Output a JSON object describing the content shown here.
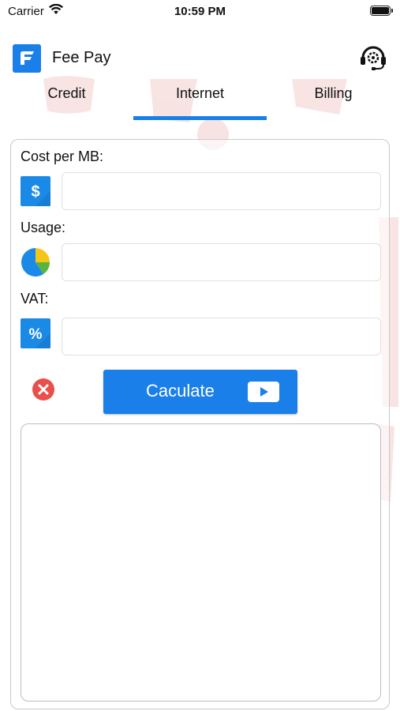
{
  "status_bar": {
    "carrier": "Carrier",
    "time": "10:59 PM"
  },
  "header": {
    "title": "Fee Pay",
    "logo_icon": "fee-pay-logo",
    "support_icon": "headset-gear-icon"
  },
  "tabs": [
    {
      "label": "Credit",
      "active": false
    },
    {
      "label": "Internet",
      "active": true
    },
    {
      "label": "Billing",
      "active": false
    }
  ],
  "form": {
    "fields": [
      {
        "label": "Cost per MB:",
        "icon": "dollar-icon",
        "value": "",
        "placeholder": ""
      },
      {
        "label": "Usage:",
        "icon": "pie-chart-icon",
        "value": "",
        "placeholder": ""
      },
      {
        "label": "VAT:",
        "icon": "percent-icon",
        "value": "",
        "placeholder": ""
      }
    ],
    "calculate_label": "Caculate",
    "clear_icon": "clear-x-icon"
  },
  "result": {
    "text": ""
  },
  "colors": {
    "accent": "#1a7fe8",
    "clear_red": "#e8504b",
    "pie_blue": "#1a8ae6",
    "pie_yellow": "#f5c518",
    "pie_green": "#58b43f"
  }
}
